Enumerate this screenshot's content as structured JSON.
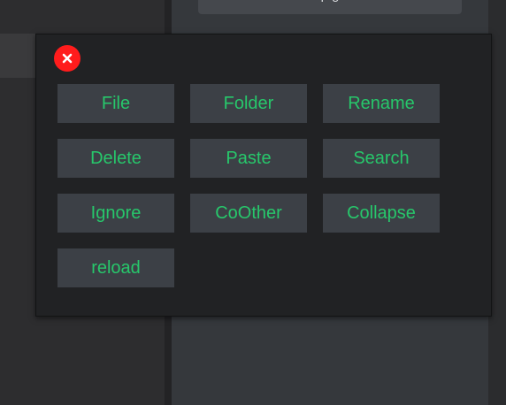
{
  "background": {
    "right_panel_input_text": "p        g"
  },
  "popup": {
    "close_icon": "close-icon",
    "buttons": [
      {
        "label": "File"
      },
      {
        "label": "Folder"
      },
      {
        "label": "Rename"
      },
      {
        "label": "Delete"
      },
      {
        "label": "Paste"
      },
      {
        "label": "Search"
      },
      {
        "label": "Ignore"
      },
      {
        "label": "CoOther"
      },
      {
        "label": "Collapse"
      },
      {
        "label": "reload"
      }
    ]
  },
  "colors": {
    "button_text": "#27c76b",
    "button_bg": "#3c4046",
    "popup_bg": "#212224",
    "close_bg": "#ff1c1c"
  }
}
